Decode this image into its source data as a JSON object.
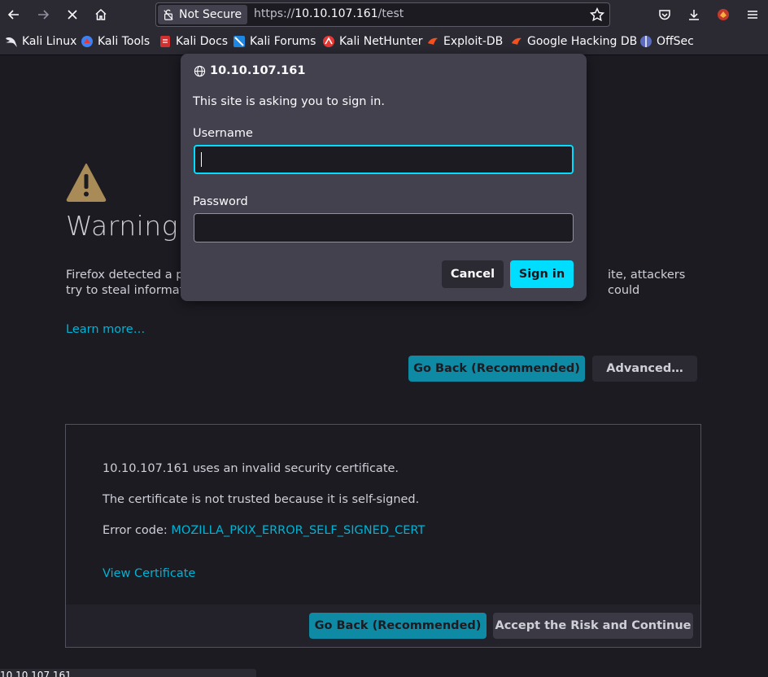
{
  "toolbar": {
    "url_prefix": "https://",
    "url_host": "10.10.107.161",
    "url_path": "/test",
    "security_label": "Not Secure"
  },
  "bookmarks": [
    {
      "label": "Kali Linux",
      "icon": "kali-dragon-icon",
      "color": "#e8e8ef"
    },
    {
      "label": "Kali Tools",
      "icon": "kali-tools-icon",
      "color": "#3b82f6"
    },
    {
      "label": "Kali Docs",
      "icon": "kali-docs-icon",
      "color": "#d32f2f"
    },
    {
      "label": "Kali Forums",
      "icon": "kali-forums-icon",
      "color": "#1e88e5"
    },
    {
      "label": "Kali NetHunter",
      "icon": "kali-nethunter-icon",
      "color": "#e53935"
    },
    {
      "label": "Exploit-DB",
      "icon": "exploit-db-icon",
      "color": "#f4511e"
    },
    {
      "label": "Google Hacking DB",
      "icon": "ghdb-icon",
      "color": "#f4511e"
    },
    {
      "label": "OffSec",
      "icon": "offsec-icon",
      "color": "#5c6bc0"
    }
  ],
  "page": {
    "warning_title": "Warning:",
    "warning_desc_left": "Firefox detected a po",
    "warning_desc_right": "ite, attackers could",
    "warning_desc_line2": "try to steal informatio",
    "learn_more": "Learn more…",
    "go_back": "Go Back (Recommended)",
    "advanced": "Advanced…",
    "adv_line1": "10.10.107.161 uses an invalid security certificate.",
    "adv_line2": "The certificate is not trusted because it is self-signed.",
    "error_code_label": "Error code: ",
    "error_code": "MOZILLA_PKIX_ERROR_SELF_SIGNED_CERT",
    "view_certificate": "View Certificate",
    "go_back_2": "Go Back (Recommended)",
    "accept_risk": "Accept the Risk and Continue"
  },
  "status_bar": {
    "text": "10.10.107.161"
  },
  "dialog": {
    "host": "10.10.107.161",
    "message": "This site is asking you to sign in.",
    "username_label": "Username",
    "username_value": "",
    "password_label": "Password",
    "password_value": "",
    "cancel": "Cancel",
    "sign_in": "Sign in"
  }
}
